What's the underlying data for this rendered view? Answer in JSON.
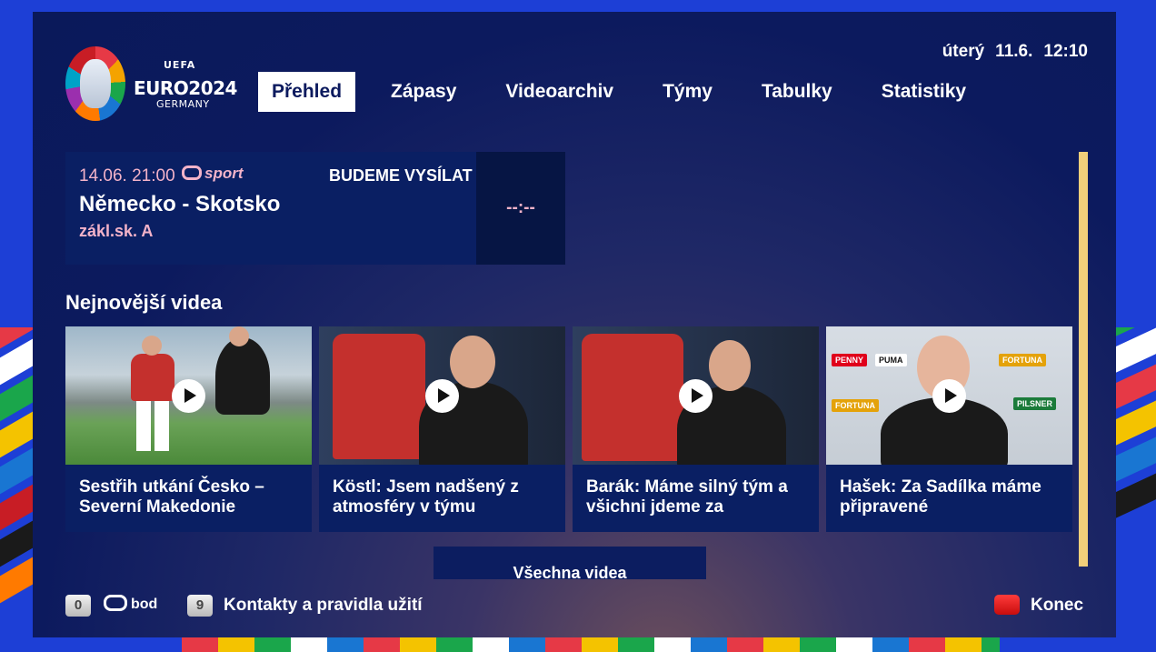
{
  "header": {
    "logo": {
      "uefa": "UEFA",
      "euro": "EURO2024",
      "country": "GERMANY"
    },
    "datetime": {
      "day": "úterý",
      "date": "11.6.",
      "time": "12:10"
    },
    "nav": [
      {
        "label": "Přehled",
        "active": true
      },
      {
        "label": "Zápasy",
        "active": false
      },
      {
        "label": "Videoarchiv",
        "active": false
      },
      {
        "label": "Týmy",
        "active": false
      },
      {
        "label": "Tabulky",
        "active": false
      },
      {
        "label": "Statistiky",
        "active": false
      }
    ]
  },
  "match": {
    "datetime": "14.06. 21:00",
    "channel": "sport",
    "status": "BUDEME VYSÍLAT",
    "title": "Německo - Skotsko",
    "group": "zákl.sk. A",
    "score": "--:--"
  },
  "videos": {
    "section_title": "Nejnovější videa",
    "items": [
      {
        "title": "Sestřih utkání Česko – Severní Makedonie"
      },
      {
        "title": "Köstl: Jsem nadšený z atmosféry v týmu"
      },
      {
        "title": "Barák: Máme silný tým a všichni jdeme za"
      },
      {
        "title": "Hašek: Za Sadílka máme připravené"
      }
    ],
    "all_label": "Všechna videa"
  },
  "footer": {
    "key_0": "0",
    "bod_label": "bod",
    "key_9": "9",
    "contacts": "Kontakty a pravidla užití",
    "exit": "Konec"
  },
  "colors": {
    "background": "#0a195a",
    "accent_pink": "#f3b3c9",
    "scrollbar": "#f2cf7a",
    "exit_key": "#e01818"
  }
}
